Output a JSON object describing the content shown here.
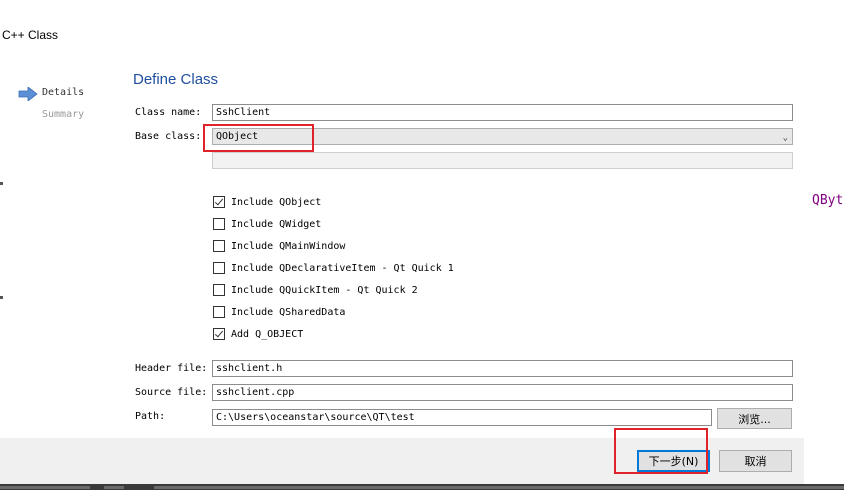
{
  "window": {
    "title": "C++ Class"
  },
  "steps": [
    {
      "label": "Details",
      "active": true
    },
    {
      "label": "Summary",
      "active": false
    }
  ],
  "section": {
    "title": "Define Class"
  },
  "form": {
    "class_name_label": "Class name:",
    "class_name_value": "SshClient",
    "base_class_label": "Base class:",
    "base_class_value": "QObject",
    "header_label": "Header file:",
    "header_value": "sshclient.h",
    "source_label": "Source file:",
    "source_value": "sshclient.cpp",
    "path_label": "Path:",
    "path_value": "C:\\Users\\oceanstar\\source\\QT\\test",
    "browse_label": "浏览..."
  },
  "options": [
    {
      "label": "Include QObject",
      "checked": true
    },
    {
      "label": "Include QWidget",
      "checked": false
    },
    {
      "label": "Include QMainWindow",
      "checked": false
    },
    {
      "label": "Include QDeclarativeItem - Qt Quick 1",
      "checked": false
    },
    {
      "label": "Include QQuickItem - Qt Quick 2",
      "checked": false
    },
    {
      "label": "Include QSharedData",
      "checked": false
    },
    {
      "label": "Add Q_OBJECT",
      "checked": true
    }
  ],
  "buttons": {
    "next": "下一步(N)",
    "cancel": "取消"
  },
  "background": {
    "side_text": "QByt"
  },
  "colors": {
    "accent": "#1f4e9e",
    "highlight": "#e0232b",
    "focus": "#0078d7"
  }
}
